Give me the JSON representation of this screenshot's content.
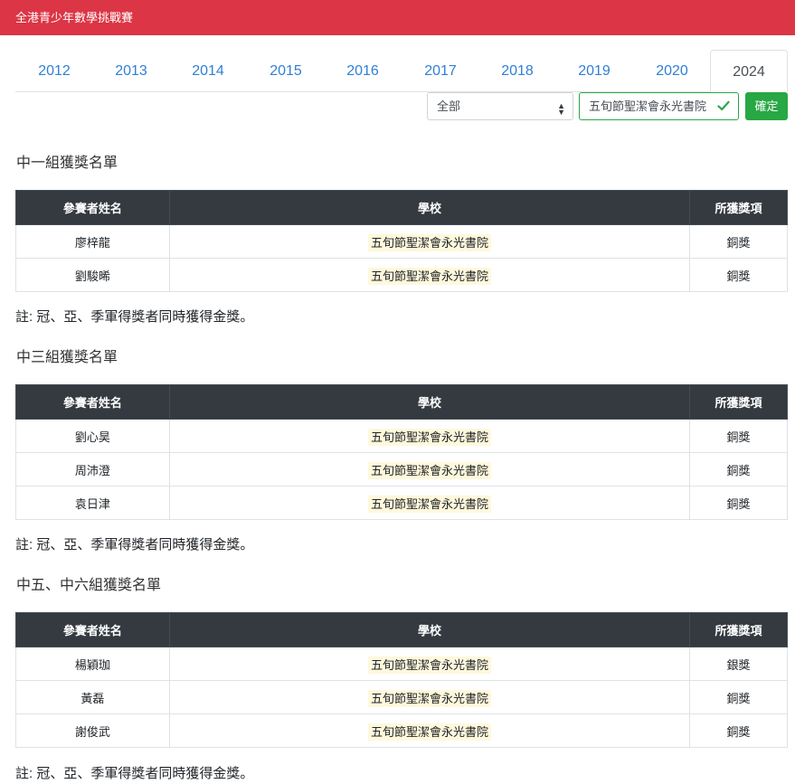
{
  "header": {
    "title": "全港青少年數學挑戰賽"
  },
  "tabs": [
    {
      "label": "2012"
    },
    {
      "label": "2013"
    },
    {
      "label": "2014"
    },
    {
      "label": "2015"
    },
    {
      "label": "2016"
    },
    {
      "label": "2017"
    },
    {
      "label": "2018"
    },
    {
      "label": "2019"
    },
    {
      "label": "2020"
    },
    {
      "label": "2024",
      "active": true
    }
  ],
  "filter": {
    "select_value": "全部",
    "school_value": "五旬節聖潔會永光書院",
    "confirm_label": "確定"
  },
  "columns": {
    "name": "參賽者姓名",
    "school": "學校",
    "award": "所獲獎項"
  },
  "sections": [
    {
      "title": "中一組獲獎名單",
      "rows": [
        {
          "name": "廖梓龍",
          "school": "五旬節聖潔會永光書院",
          "award": "銅獎"
        },
        {
          "name": "劉駿晞",
          "school": "五旬節聖潔會永光書院",
          "award": "銅獎"
        }
      ],
      "note": "註: 冠、亞、季軍得獎者同時獲得金獎。"
    },
    {
      "title": "中三組獲獎名單",
      "rows": [
        {
          "name": "劉心昊",
          "school": "五旬節聖潔會永光書院",
          "award": "銅獎"
        },
        {
          "name": "周沛澄",
          "school": "五旬節聖潔會永光書院",
          "award": "銅獎"
        },
        {
          "name": "袁日津",
          "school": "五旬節聖潔會永光書院",
          "award": "銅獎"
        }
      ],
      "note": "註: 冠、亞、季軍得獎者同時獲得金獎。"
    },
    {
      "title": "中五、中六組獲獎名單",
      "rows": [
        {
          "name": "楊穎珈",
          "school": "五旬節聖潔會永光書院",
          "award": "銀獎"
        },
        {
          "name": "黃磊",
          "school": "五旬節聖潔會永光書院",
          "award": "銅獎"
        },
        {
          "name": "謝俊武",
          "school": "五旬節聖潔會永光書院",
          "award": "銅獎"
        }
      ],
      "note": "註: 冠、亞、季軍得獎者同時獲得金獎。"
    }
  ],
  "colors": {
    "header_bg": "#dc3545",
    "confirm_bg": "#28a745",
    "table_head_bg": "#343a40",
    "tab_link": "#2f7fd6",
    "highlight": "#fff8dc"
  }
}
